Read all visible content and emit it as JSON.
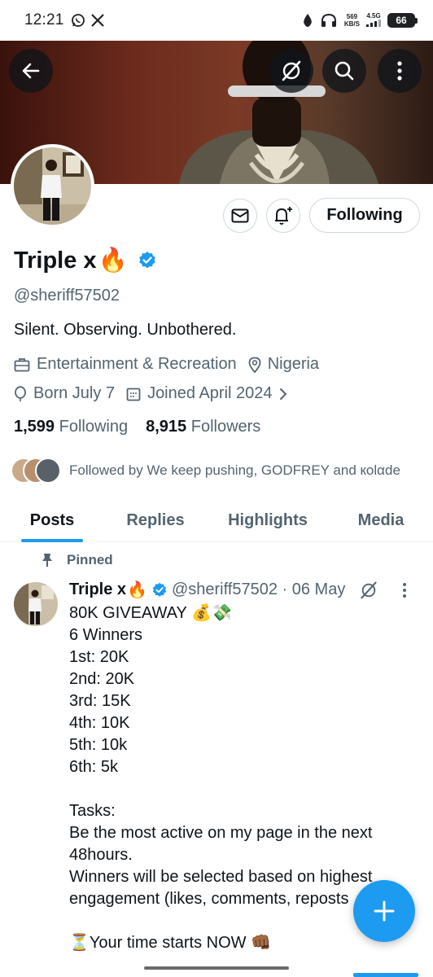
{
  "status_bar": {
    "time": "12:21",
    "net_speed_value": "569",
    "net_speed_unit": "KB/S",
    "network_type": "4.5G",
    "battery": "66"
  },
  "profile": {
    "display_name": "Triple x",
    "name_emoji": "🔥",
    "handle": "@sheriff57502",
    "bio": "Silent. Observing. Unbothered.",
    "category": "Entertainment & Recreation",
    "location": "Nigeria",
    "birthday": "Born July 7",
    "joined": "Joined April 2024",
    "following_count": "1,599",
    "following_label": "Following",
    "followers_count": "8,915",
    "followers_label": "Followers",
    "followed_by": "Followed by We keep pushing, GODFREY and кolαde",
    "follow_button_label": "Following"
  },
  "tabs": [
    {
      "label": "Posts",
      "active": true
    },
    {
      "label": "Replies",
      "active": false
    },
    {
      "label": "Highlights",
      "active": false
    },
    {
      "label": "Media",
      "active": false
    }
  ],
  "pinned_tweet": {
    "pinned_label": "Pinned",
    "author_name": "Triple x",
    "author_emoji": "🔥",
    "meta": "@sheriff57502 · 06 May",
    "lines": [
      "80K GIVEAWAY 💰💸",
      "6 Winners",
      "1st:  20K",
      "2nd: 20K",
      "3rd: 15K",
      "4th: 10K",
      "5th: 10k",
      "6th: 5k",
      "",
      "Tasks:",
      "Be the most active on my page in the next",
      "48hours.",
      "Winners will be selected based on highest",
      "engagement (likes, comments, reposts",
      "",
      "⏳Your time starts NOW 👊🏾"
    ]
  },
  "colors": {
    "accent": "#1d9bf0",
    "text_primary": "#0f1419",
    "text_secondary": "#536471",
    "border": "#cfd9de"
  }
}
